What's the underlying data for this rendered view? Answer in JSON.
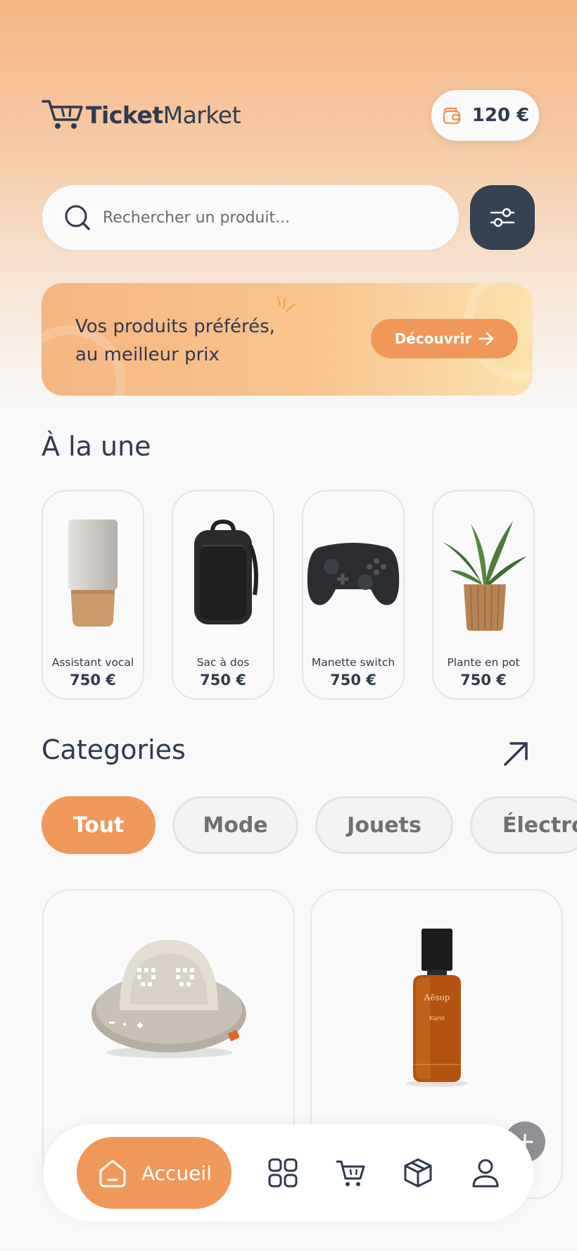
{
  "header": {
    "logo_brand_bold": "Ticket",
    "logo_brand_regular": "Market",
    "wallet_amount": "120 €"
  },
  "search": {
    "placeholder": "Rechercher un produit..."
  },
  "banner": {
    "line1": "Vos produits préférés,",
    "line2": "au meilleur prix",
    "button_label": "Découvrir"
  },
  "featured": {
    "title": "À la une",
    "items": [
      {
        "name": "Assistant vocal",
        "price": "750 €",
        "icon": "smart-speaker-image"
      },
      {
        "name": "Sac à dos",
        "price": "750 €",
        "icon": "backpack-image"
      },
      {
        "name": "Manette switch",
        "price": "750 €",
        "icon": "game-controller-image"
      },
      {
        "name": "Plante en pot",
        "price": "750 €",
        "icon": "potted-plant-image"
      }
    ]
  },
  "categories": {
    "title": "Categories",
    "chips": [
      "Tout",
      "Mode",
      "Jouets",
      "Électro"
    ],
    "active": "Tout"
  },
  "products": [
    {
      "icon": "robot-speaker-image"
    },
    {
      "icon": "perfume-bottle-image",
      "bottle_label": "Aēsop",
      "bottle_sub": "Karst"
    }
  ],
  "bottom_nav": {
    "home_label": "Accueil",
    "items": [
      "home-icon",
      "grid-icon",
      "cart-icon",
      "box-icon",
      "user-icon"
    ]
  },
  "colors": {
    "accent": "#f0985a",
    "dark": "#364152",
    "text": "#2f3a4d"
  }
}
